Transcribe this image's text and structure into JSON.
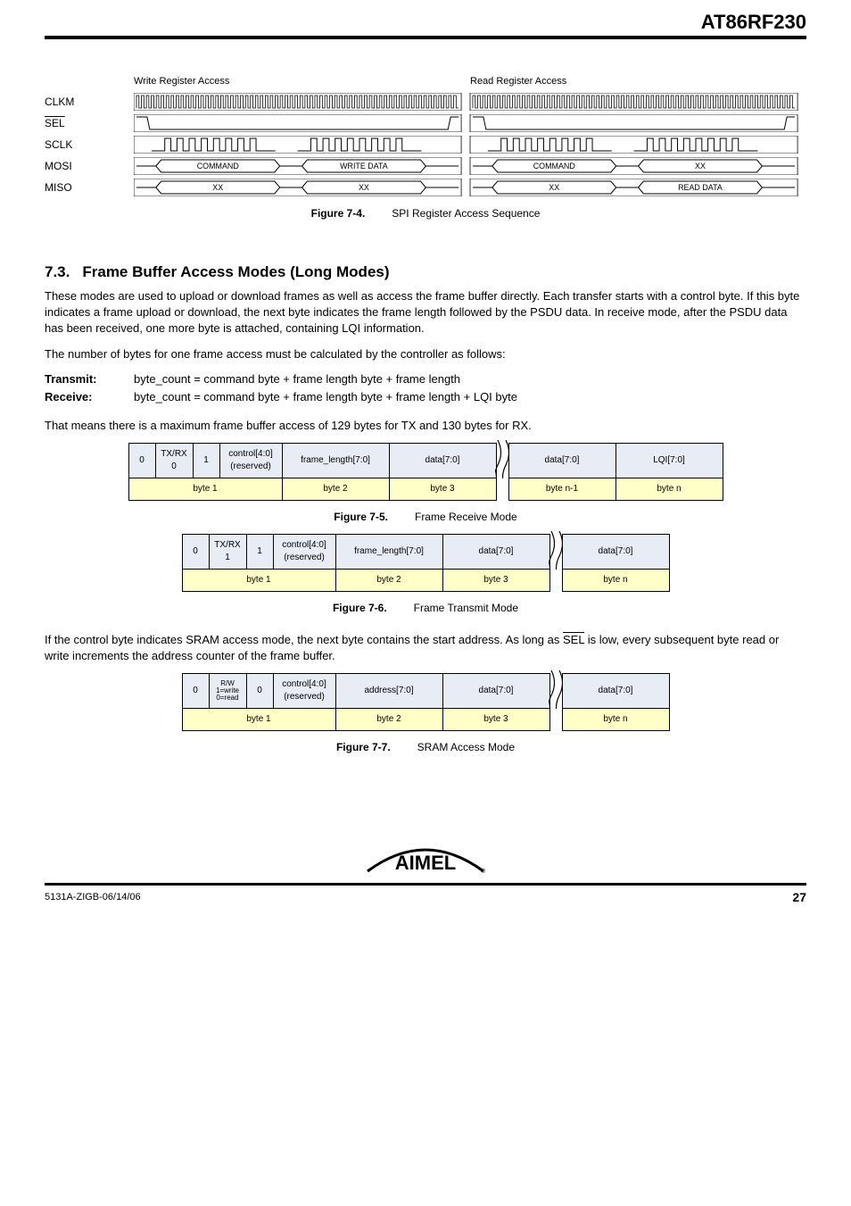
{
  "doc_title": "AT86RF230",
  "timing": {
    "write_header": "Write Register Access",
    "read_header": "Read Register Access",
    "signals": [
      "CLKM",
      "SEL",
      "SCLK",
      "MOSI",
      "MISO"
    ],
    "mosi_write": [
      "COMMAND",
      "WRITE DATA"
    ],
    "miso_write": [
      "XX",
      "XX"
    ],
    "mosi_read": [
      "COMMAND",
      "XX"
    ],
    "miso_read": [
      "XX",
      "READ DATA"
    ]
  },
  "fig74": {
    "label": "Figure 7-4.",
    "caption": "SPI Register Access Sequence"
  },
  "section": {
    "num": "7.3.",
    "title": "Frame Buffer Access Modes (Long Modes)"
  },
  "para1": "These modes are used to upload or download frames as well as access the frame buffer directly. Each transfer starts with a control byte. If this byte indicates a frame upload or download, the next byte indicates the frame length followed by the PSDU data. In receive mode, after the PSDU data has been received, one more byte is attached, containing LQI information.",
  "para2": "The number of bytes for one frame access must be calculated by the controller as follows:",
  "tx_label": "Transmit:",
  "tx_formula": "byte_count = command byte + frame length byte + frame length",
  "rx_label": "Receive:",
  "rx_formula": "byte_count = command byte + frame length byte + frame length + LQI byte",
  "para3": "That means there is a maximum frame buffer access of 129 bytes for TX and 130 bytes for RX.",
  "fig75": {
    "label": "Figure 7-5.",
    "caption": "Frame Receive Mode",
    "top": [
      "0",
      "TX/RX\n0",
      "1",
      "control[4:0]\n(reserved)",
      "frame_length[7:0]",
      "data[7:0]",
      "data[7:0]",
      "LQI[7:0]"
    ],
    "bot": [
      "byte 1",
      "byte 2",
      "byte 3",
      "byte n-1",
      "byte n"
    ]
  },
  "fig76": {
    "label": "Figure 7-6.",
    "caption": "Frame Transmit Mode",
    "top": [
      "0",
      "TX/RX\n1",
      "1",
      "control[4:0]\n(reserved)",
      "frame_length[7:0]",
      "data[7:0]",
      "data[7:0]"
    ],
    "bot": [
      "byte 1",
      "byte 2",
      "byte 3",
      "byte n"
    ]
  },
  "para4_a": "If the control byte indicates SRAM access mode, the next byte contains the start address. As long as ",
  "para4_sel": "SEL",
  "para4_b": " is low, every subsequent byte read or write increments the address counter of the frame buffer.",
  "fig77": {
    "label": "Figure 7-7.",
    "caption": "SRAM Access Mode",
    "top": [
      "0",
      "R/W\n1=write\n0=read",
      "0",
      "control[4:0]\n(reserved)",
      "address[7:0]",
      "data[7:0]",
      "data[7:0]"
    ],
    "bot": [
      "byte 1",
      "byte 2",
      "byte 3",
      "byte n"
    ]
  },
  "footer": {
    "docid": "5131A-ZIGB-06/14/06",
    "page": "27"
  }
}
